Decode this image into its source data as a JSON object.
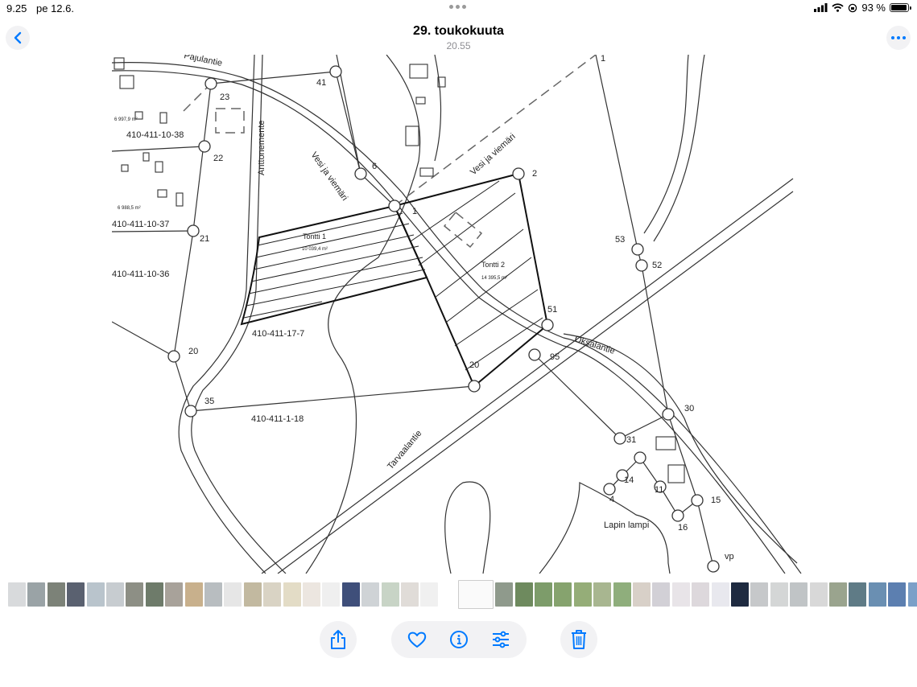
{
  "status_bar": {
    "time": "9.25",
    "date": "pe 12.6.",
    "battery_percent": "93 %",
    "battery_level": 0.93
  },
  "header": {
    "title": "29. toukokuuta",
    "subtitle": "20.55"
  },
  "map": {
    "roads": [
      "Pajulantie",
      "Anttonemente",
      "Tarvaalantie",
      "Oksalantie"
    ],
    "pipe_labels": [
      "Vesi ja viemäri",
      "Vesi ja viemäri"
    ],
    "parcels": [
      "410-411-10-38",
      "410-411-10-37",
      "410-411-10-36",
      "410-411-17-7",
      "410-411-1-18"
    ],
    "areas": [
      "6 997,9 m²",
      "6 988,5 m²",
      "10 039,4 m²",
      "14 395,5 m²"
    ],
    "plots": [
      "Tontti 1",
      "Tontti 2"
    ],
    "lake": "Lapin lampi",
    "point_labels": [
      "41",
      "23",
      "22",
      "21",
      "20",
      "35",
      "6",
      "1",
      "2",
      "53",
      "52",
      "51",
      "95",
      "20",
      "30",
      "31",
      "14",
      "4",
      "11",
      "15",
      "16",
      "vp",
      "1"
    ]
  },
  "toolbar": {
    "icons": [
      "share-icon",
      "heart-icon",
      "info-icon",
      "adjust-icon",
      "trash-icon"
    ]
  },
  "colors": {
    "accent": "#007aff",
    "button_bg": "#f2f2f4",
    "map_line": "#333333"
  }
}
